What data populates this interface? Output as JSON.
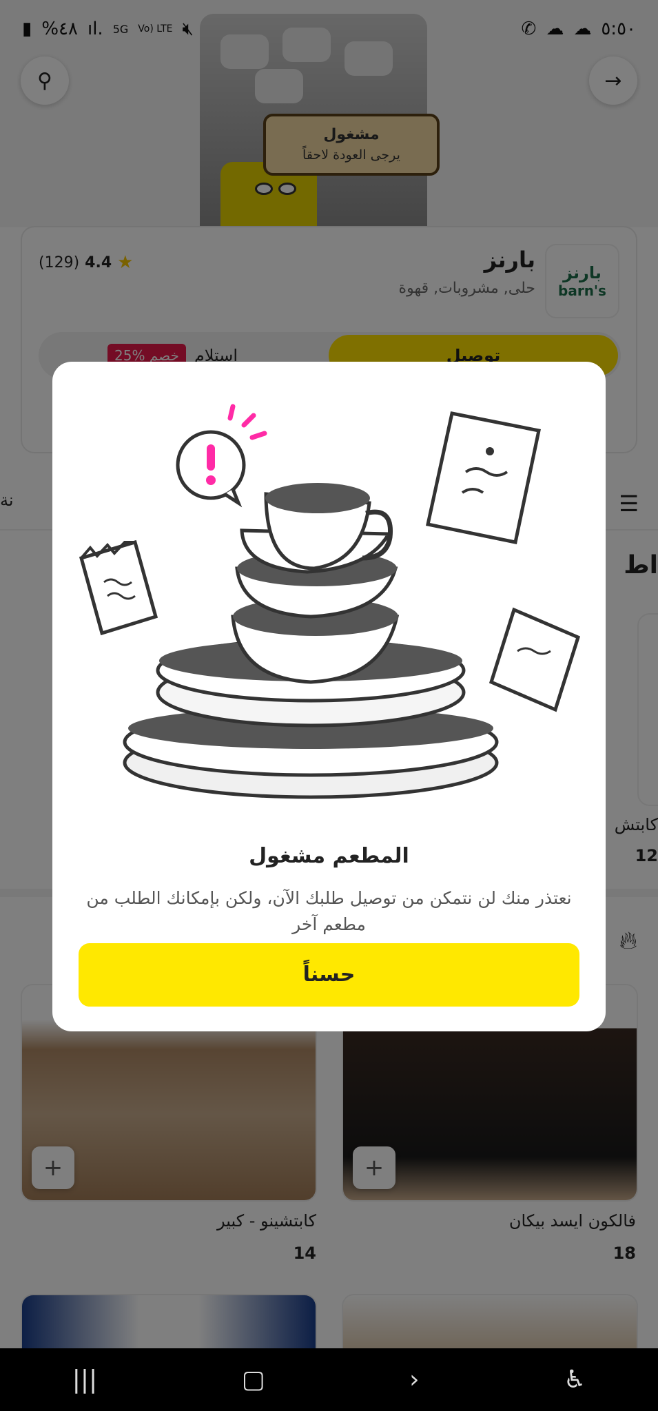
{
  "status_bar": {
    "time": "٥:٥٠",
    "battery": "%٤٨",
    "net": "5G",
    "volte": "Vo) LTE"
  },
  "hero": {
    "busy_title": "مشغول",
    "busy_subtitle": "يرجى العودة لاحقاً"
  },
  "restaurant": {
    "name": "بارنز",
    "categories": "حلى, مشروبات, قهوة",
    "rating": "4.4",
    "reviews": "(129)",
    "logo_ar": "بارنز",
    "logo_en": "barn's",
    "delivery_label": "توصيل",
    "pickup_label": "استلام",
    "discount_badge": "25% خصم"
  },
  "menu": {
    "section_title": "اط",
    "tab_peek": "نة",
    "products": [
      {
        "name": "فالكون ايسد بيكان",
        "price": "18"
      },
      {
        "name": "كابتشينو - كبير",
        "price": "14"
      }
    ],
    "peek_product_name": "كابتش",
    "peek_product_price": "12"
  },
  "modal": {
    "title": "المطعم مشغول",
    "message": "نعتذر منك لن نتمكن من توصيل طلبك الآن، ولكن بإمكانك الطلب من مطعم آخر",
    "ok_button": "حسناً"
  },
  "colors": {
    "accent_yellow": "#ffe800",
    "discount_red": "#e8184a",
    "exclamation_pink": "#ff2ba6"
  },
  "icons": [
    "search-icon",
    "arrow-forward-icon",
    "menu-icon",
    "star-icon",
    "fire-icon",
    "plus-icon"
  ]
}
